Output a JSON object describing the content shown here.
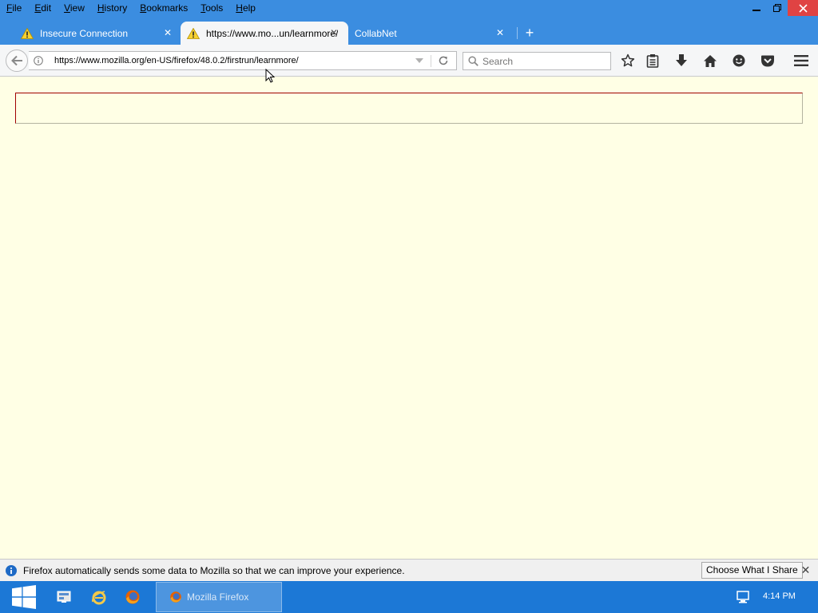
{
  "menubar": {
    "items": [
      {
        "mnemonic": "F",
        "rest": "ile"
      },
      {
        "mnemonic": "E",
        "rest": "dit"
      },
      {
        "mnemonic": "V",
        "rest": "iew"
      },
      {
        "mnemonic": "H",
        "rest": "istory"
      },
      {
        "mnemonic": "B",
        "rest": "ookmarks"
      },
      {
        "mnemonic": "T",
        "rest": "ools"
      },
      {
        "mnemonic": "H",
        "rest": "elp"
      }
    ]
  },
  "tabs": [
    {
      "title": "Insecure Connection",
      "icon": "warning-icon",
      "active": false
    },
    {
      "title": "https://www.mo...un/learnmore/",
      "icon": "warning-icon",
      "active": true
    },
    {
      "title": "CollabNet",
      "icon": "",
      "active": false
    }
  ],
  "newtab_label": "+",
  "navbar": {
    "url": "https://www.mozilla.org/en-US/firefox/48.0.2/firstrun/learnmore/",
    "search_placeholder": "Search"
  },
  "notification": {
    "message": "Firefox automatically sends some data to Mozilla so that we can improve your experience.",
    "button_label": "Choose What I Share"
  },
  "taskbar": {
    "active_window_label": "Mozilla Firefox",
    "clock": "4:14 PM"
  },
  "colors": {
    "titlebar": "#3b8de0",
    "content_background": "#ffffe5",
    "taskbar": "#1c78d6",
    "close_button": "#e04343"
  }
}
